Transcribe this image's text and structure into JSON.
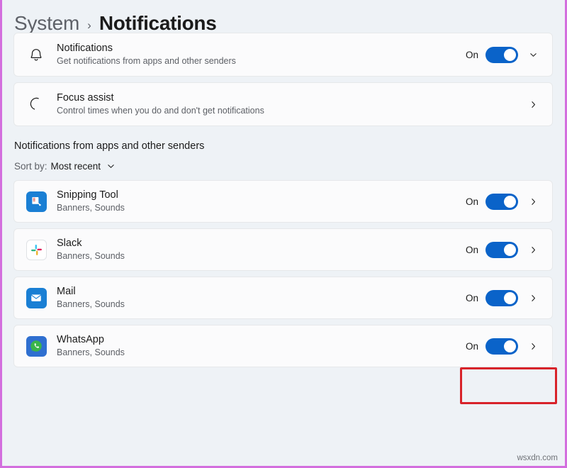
{
  "breadcrumb": {
    "parent": "System",
    "separator": "›",
    "current": "Notifications"
  },
  "settings_cards": [
    {
      "icon": "bell-icon",
      "title": "Notifications",
      "subtitle": "Get notifications from apps and other senders",
      "state": "On",
      "has_toggle": true,
      "chevron": "chevron-down-icon"
    },
    {
      "icon": "moon-icon",
      "title": "Focus assist",
      "subtitle": "Control times when you do and don't get notifications",
      "state": "",
      "has_toggle": false,
      "chevron": "chevron-right-icon"
    }
  ],
  "section": {
    "heading": "Notifications from apps and other senders",
    "sort_label": "Sort by:",
    "sort_value": "Most recent",
    "sort_chevron": "chevron-down-icon"
  },
  "app_rows": [
    {
      "icon": "snipping-tool-icon",
      "title": "Snipping Tool",
      "subtitle": "Banners, Sounds",
      "state": "On",
      "chevron": "chevron-right-icon",
      "highlighted": false
    },
    {
      "icon": "slack-icon",
      "title": "Slack",
      "subtitle": "Banners, Sounds",
      "state": "On",
      "chevron": "chevron-right-icon",
      "highlighted": false
    },
    {
      "icon": "mail-icon",
      "title": "Mail",
      "subtitle": "Banners, Sounds",
      "state": "On",
      "chevron": "chevron-right-icon",
      "highlighted": true
    },
    {
      "icon": "whatsapp-icon",
      "title": "WhatsApp",
      "subtitle": "Banners, Sounds",
      "state": "On",
      "chevron": "chevron-right-icon",
      "highlighted": false
    }
  ],
  "watermark": "wsxdn.com",
  "colors": {
    "page_background": "#eef2f6",
    "card_background": "#fbfbfc",
    "toggle_on": "#0a63c9",
    "highlight_border": "#d8232a",
    "page_border": "#d36ede",
    "title_text": "#1b1b1b",
    "subtitle_text": "#5d6066"
  }
}
